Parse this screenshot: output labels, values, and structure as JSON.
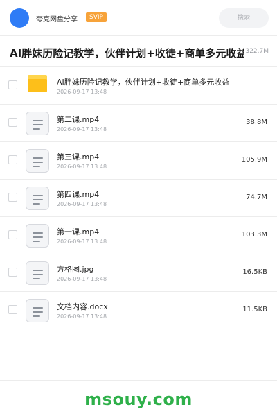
{
  "header": {
    "username": "夸克网盘分享",
    "badge": "SVIP",
    "search_placeholder": "搜索"
  },
  "share": {
    "title": "AI胖妹历险记教学，伙伴计划+收徒+商单多元收益",
    "total_size": "322.7M"
  },
  "files": [
    {
      "type": "folder",
      "name": "AI胖妹历险记教学，伙伴计划+收徒+商单多元收益",
      "date": "2026-09-17 13:48",
      "size": ""
    },
    {
      "type": "file",
      "name": "第二课.mp4",
      "date": "2026-09-17 13:48",
      "size": "38.8M"
    },
    {
      "type": "file",
      "name": "第三课.mp4",
      "date": "2026-09-17 13:48",
      "size": "105.9M"
    },
    {
      "type": "file",
      "name": "第四课.mp4",
      "date": "2026-09-17 13:48",
      "size": "74.7M"
    },
    {
      "type": "file",
      "name": "第一课.mp4",
      "date": "2026-09-17 13:48",
      "size": "103.3M"
    },
    {
      "type": "file",
      "name": "方格图.jpg",
      "date": "2026-09-17 13:48",
      "size": "16.5KB"
    },
    {
      "type": "file",
      "name": "文档内容.docx",
      "date": "2026-09-17 13:48",
      "size": "11.5KB"
    }
  ],
  "footer": {
    "watermark": "msouy.com"
  },
  "colors": {
    "avatar": "#2f7cf6",
    "badge": "#f7a33a",
    "folder": "#fdbf1a",
    "watermark": "#2fb04a"
  }
}
